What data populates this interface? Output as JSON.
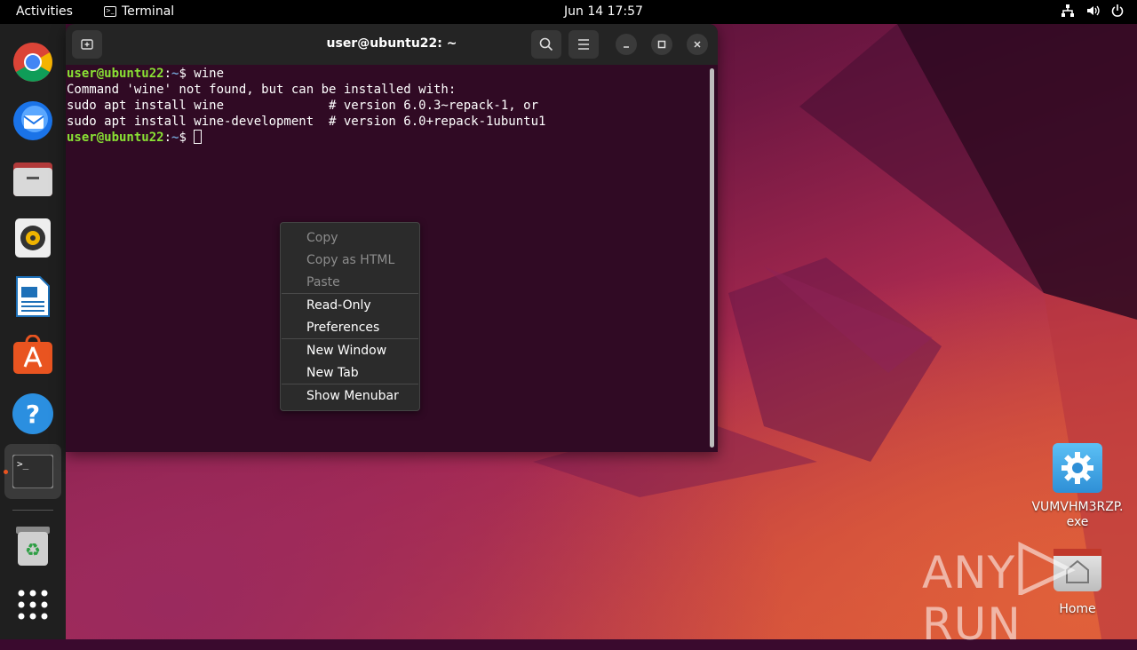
{
  "topbar": {
    "activities": "Activities",
    "app_name": "Terminal",
    "clock": "Jun 14  17:57",
    "tray": [
      "network-icon",
      "volume-icon",
      "power-icon"
    ]
  },
  "dock": {
    "items": [
      "chrome",
      "thunderbird",
      "files",
      "rhythmbox",
      "libreoffice-writer",
      "app-center",
      "help",
      "terminal",
      "trash",
      "show-apps"
    ]
  },
  "terminal": {
    "title": "user@ubuntu22: ~",
    "lines": [
      {
        "user": "user@ubuntu22",
        "path": "~",
        "cmd": "$ wine"
      },
      {
        "text": "Command 'wine' not found, but can be installed with:"
      },
      {
        "text": "sudo apt install wine              # version 6.0.3~repack-1, or"
      },
      {
        "text": "sudo apt install wine-development  # version 6.0+repack-1ubuntu1"
      },
      {
        "user": "user@ubuntu22",
        "path": "~",
        "cmd": "$ "
      }
    ],
    "colors": {
      "background": "#300a24",
      "user": "#8ae234",
      "path": "#729fcf"
    }
  },
  "context_menu": {
    "items": [
      {
        "label": "Copy",
        "enabled": false
      },
      {
        "label": "Copy as HTML",
        "enabled": false
      },
      {
        "label": "Paste",
        "enabled": false
      },
      {
        "label": "Read-Only",
        "enabled": true
      },
      {
        "label": "Preferences",
        "enabled": true
      },
      {
        "label": "New Window",
        "enabled": true
      },
      {
        "label": "New Tab",
        "enabled": true
      },
      {
        "label": "Show Menubar",
        "enabled": true
      }
    ]
  },
  "desktop": {
    "icons": [
      {
        "label": "VUMVHM3RZP.\nexe",
        "icon": "gear-executable-icon"
      },
      {
        "label": "Home",
        "icon": "home-folder-icon"
      }
    ]
  },
  "watermark": "ANY RUN"
}
